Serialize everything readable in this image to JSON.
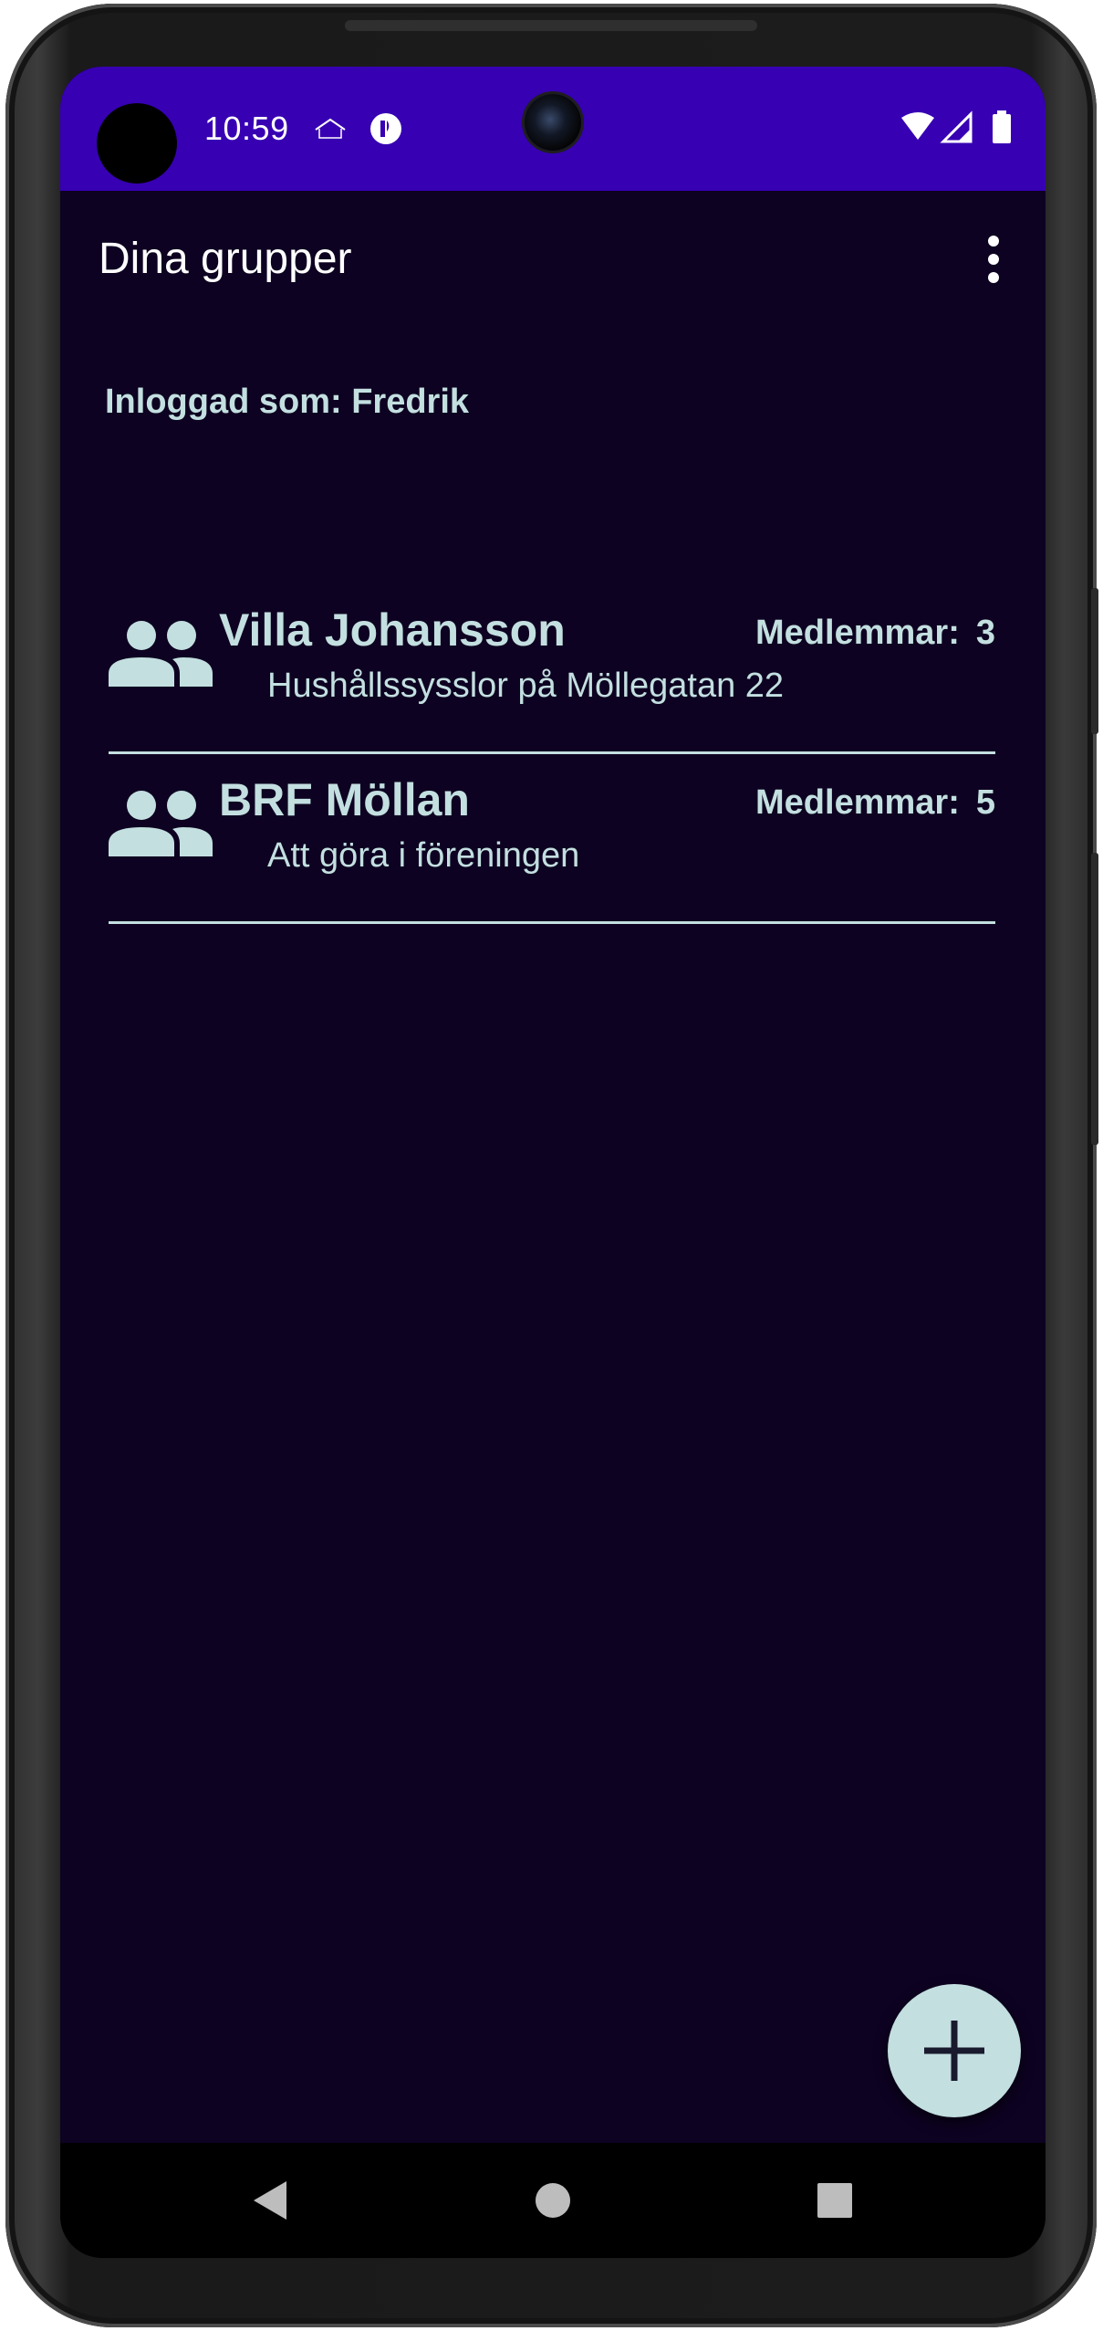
{
  "status_bar": {
    "time": "10:59"
  },
  "app_bar": {
    "title": "Dina grupper"
  },
  "user": {
    "logged_in_label": "Inloggad som: Fredrik"
  },
  "groups": [
    {
      "name": "Villa Johansson",
      "description": "Hushållssysslor på Möllegatan 22",
      "members_label": "Medlemmar:",
      "members_count": "3"
    },
    {
      "name": "BRF Möllan",
      "description": "Att göra i föreningen",
      "members_label": "Medlemmar:",
      "members_count": "5"
    }
  ],
  "icons": {
    "group": "group-icon",
    "more": "more-vert-icon",
    "add": "plus-icon",
    "nav_back": "back-triangle-icon",
    "nav_home": "home-circle-icon",
    "nav_recents": "recents-square-icon"
  },
  "colors": {
    "background": "#0d0221",
    "status_bar": "#3700b3",
    "accent": "#c3dfe0",
    "nav_bar": "#000000"
  }
}
